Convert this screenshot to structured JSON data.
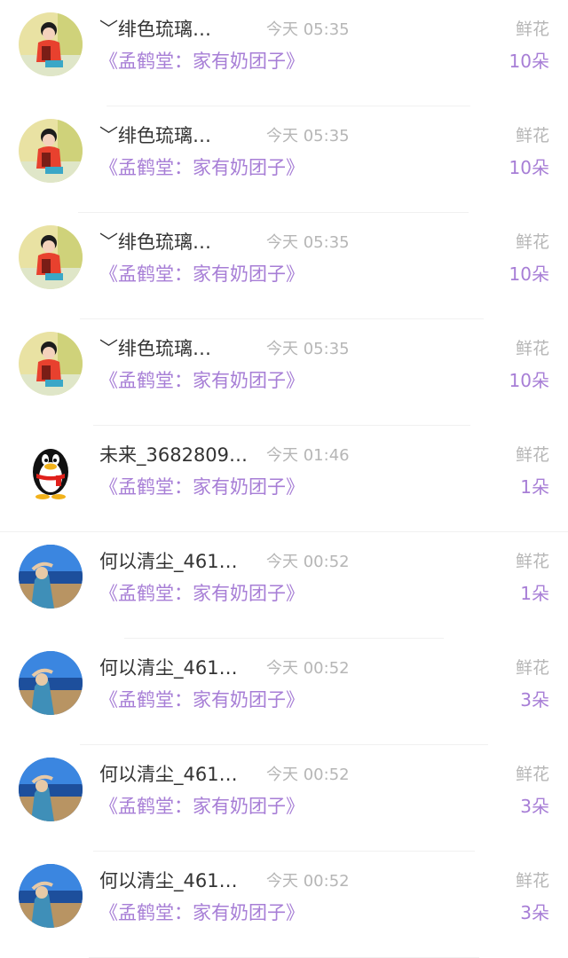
{
  "records": [
    {
      "avatar": "girl-avatar",
      "name": "﹀绯色琉璃…",
      "time": "今天 05:35",
      "gift": "鲜花",
      "book": "《孟鹤堂：家有奶团子》",
      "count": "10朵"
    },
    {
      "avatar": "girl-avatar",
      "name": "﹀绯色琉璃…",
      "time": "今天 05:35",
      "gift": "鲜花",
      "book": "《孟鹤堂：家有奶团子》",
      "count": "10朵"
    },
    {
      "avatar": "girl-avatar",
      "name": "﹀绯色琉璃…",
      "time": "今天 05:35",
      "gift": "鲜花",
      "book": "《孟鹤堂：家有奶团子》",
      "count": "10朵"
    },
    {
      "avatar": "girl-avatar",
      "name": "﹀绯色琉璃…",
      "time": "今天 05:35",
      "gift": "鲜花",
      "book": "《孟鹤堂：家有奶团子》",
      "count": "10朵"
    },
    {
      "avatar": "qq-penguin-avatar",
      "name": "未来_3682809…",
      "time": "今天 01:46",
      "gift": "鲜花",
      "book": "《孟鹤堂：家有奶团子》",
      "count": "1朵"
    },
    {
      "avatar": "seaside-avatar",
      "name": "何以清尘_461…",
      "time": "今天 00:52",
      "gift": "鲜花",
      "book": "《孟鹤堂：家有奶团子》",
      "count": "1朵"
    },
    {
      "avatar": "seaside-avatar",
      "name": "何以清尘_461…",
      "time": "今天 00:52",
      "gift": "鲜花",
      "book": "《孟鹤堂：家有奶团子》",
      "count": "3朵"
    },
    {
      "avatar": "seaside-avatar",
      "name": "何以清尘_461…",
      "time": "今天 00:52",
      "gift": "鲜花",
      "book": "《孟鹤堂：家有奶团子》",
      "count": "3朵"
    },
    {
      "avatar": "seaside-avatar",
      "name": "何以清尘_461…",
      "time": "今天 00:52",
      "gift": "鲜花",
      "book": "《孟鹤堂：家有奶团子》",
      "count": "3朵"
    }
  ],
  "colors": {
    "accent": "#a77ed6",
    "muted": "#b6b6b6",
    "text": "#333333"
  }
}
